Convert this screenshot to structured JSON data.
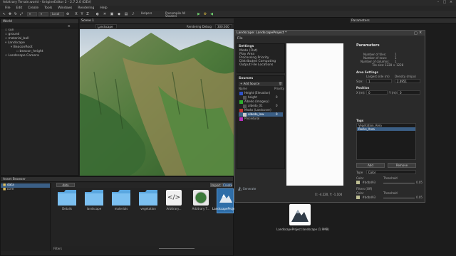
{
  "window": {
    "title": "Arbitrary Terrain.world - UnigineEditor 2 - 2.7.2.0 (DEV)"
  },
  "menu": [
    "File",
    "Edit",
    "Create",
    "Tools",
    "Windows",
    "Rendering",
    "Help"
  ],
  "toolbar": {
    "local_label": "Local",
    "axis": [
      "X",
      "Y",
      "Z"
    ],
    "helpers_label": "Helpers",
    "shaders_label": "Precompile All Shaders"
  },
  "world": {
    "title": "World",
    "items": [
      "sun",
      "ground",
      "material_ball",
      "Landscape",
      "BeaconRoot",
      "beacon_height",
      "Landscape Camera"
    ]
  },
  "scene": {
    "tab": "Scene 1",
    "camera": "Landscape Cam",
    "rendering_label": "Rendering Debug",
    "res": "300:300"
  },
  "browser": {
    "title": "Asset Browser",
    "tree": [
      "data",
      "core"
    ],
    "path": "data",
    "import_label": "Import",
    "create_label": "Create",
    "tiles": [
      "Details",
      "landscape",
      "materials",
      "vegetation",
      "Arbitrary...",
      "Arbitrary T...",
      "LandscapeProject..."
    ],
    "footer": "Filters"
  },
  "parameters_tab": "Parameters",
  "desktop_icon_label": "LandscapeProject.landscape (1.9MB)",
  "landscape": {
    "tab": "Landscape: LandscapeProject *",
    "file_menu": "File",
    "settings_title": "Settings",
    "settings": [
      "Mode (Flat)",
      "Play Area",
      "Processing Priority",
      "Distributed Computing",
      "Output File Locations"
    ],
    "sources_title": "Sources",
    "add_source": "Add Source",
    "col_name": "Name",
    "col_priority": "Priority",
    "sources": [
      {
        "name": "Height (Elevation)",
        "color": "#2f52c7",
        "priority": ""
      },
      {
        "name": "height",
        "color": "#2a2a2a",
        "priority": "0"
      },
      {
        "name": "Albedo (Imagery)",
        "color": "#2fb02f",
        "priority": ""
      },
      {
        "name": "albedo_01",
        "color": "#2a2a2a",
        "priority": "0"
      },
      {
        "name": "Masks (Landcover)",
        "color": "#c73030",
        "priority": ""
      },
      {
        "name": "albedo_low",
        "color": "#2a2a2a",
        "priority": "0"
      },
      {
        "name": "Procedural",
        "color": "#b830c0",
        "priority": ""
      }
    ],
    "logo": "Generate",
    "coords": "X: -4.220, Y: -1.104",
    "params": {
      "title": "Parameters",
      "num_tiles_label": "Number of tiles:",
      "num_tiles": "1",
      "num_rows_label": "Number of rows:",
      "num_rows": "1",
      "num_cols_label": "Number of columns:",
      "num_cols": "1",
      "tile_size_label": "Tile size:",
      "tile_size": "1228 × 1228",
      "area_title": "Area Settings",
      "largest_label": "Largest side (m)",
      "density_label": "Density (m/px)",
      "size_label": "Size:",
      "size": "1",
      "density": "2.4951",
      "position_title": "Position",
      "x_label": "X (m):",
      "x_val": "0",
      "y_label": "Y (m):",
      "y_val": "0",
      "tags_title": "Tags",
      "tags": [
        "Vegetation_Area",
        "Rocks_Area"
      ],
      "add_label": "Add",
      "remove_label": "Remove",
      "type_label": "Type",
      "type_val": "Color",
      "color_label": "Color",
      "threshold_label": "Threshold",
      "color_val": "#bdbd93",
      "threshold_val": "0.05",
      "filters_label": "Filters (Off)",
      "color2_val": "#bdbd93",
      "threshold2_val": "0.05"
    }
  }
}
